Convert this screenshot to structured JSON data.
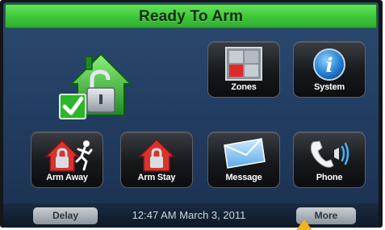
{
  "status": {
    "text": "Ready To Arm",
    "color": "#3ec63a"
  },
  "home_status_icon": {
    "icon": "house-lock-check-icon"
  },
  "tiles": {
    "zones": {
      "label": "Zones",
      "icon": "zones-icon"
    },
    "system": {
      "label": "System",
      "icon": "info-icon"
    },
    "arm_away": {
      "label": "Arm Away",
      "icon": "arm-away-icon"
    },
    "arm_stay": {
      "label": "Arm Stay",
      "icon": "arm-stay-icon"
    },
    "message": {
      "label": "Message",
      "icon": "envelope-icon"
    },
    "phone": {
      "label": "Phone",
      "icon": "phone-icon"
    }
  },
  "bottom_bar": {
    "delay_label": "Delay",
    "datetime": "12:47 AM  March 3, 2011",
    "more_label": "More"
  }
}
